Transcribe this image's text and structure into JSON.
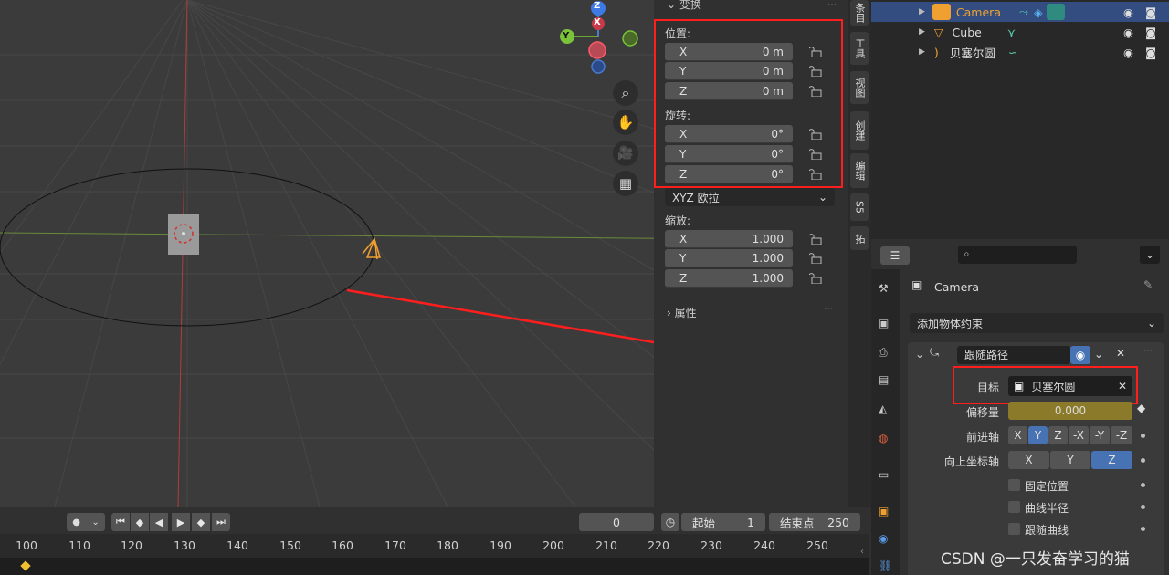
{
  "npanel": {
    "transform_header": "变换",
    "location_label": "位置:",
    "location": [
      {
        "axis": "X",
        "value": "0 m"
      },
      {
        "axis": "Y",
        "value": "0 m"
      },
      {
        "axis": "Z",
        "value": "0 m"
      }
    ],
    "rotation_label": "旋转:",
    "rotation": [
      {
        "axis": "X",
        "value": "0°"
      },
      {
        "axis": "Y",
        "value": "0°"
      },
      {
        "axis": "Z",
        "value": "0°"
      }
    ],
    "rotation_mode": "XYZ 欧拉",
    "scale_label": "缩放:",
    "scale": [
      {
        "axis": "X",
        "value": "1.000"
      },
      {
        "axis": "Y",
        "value": "1.000"
      },
      {
        "axis": "Z",
        "value": "1.000"
      }
    ],
    "properties_header": "属性"
  },
  "sidetabs": [
    "条目",
    "工具",
    "视图",
    "创建",
    "编辑",
    "S5",
    "拓"
  ],
  "gizmo": {
    "z": "Z",
    "y": "Y",
    "x": "X"
  },
  "outliner": {
    "rows": [
      {
        "name": "Camera",
        "selected": true
      },
      {
        "name": "Cube",
        "selected": false
      },
      {
        "name": "贝塞尔圆",
        "selected": false
      }
    ]
  },
  "properties": {
    "object_name": "Camera",
    "add_constraint": "添加物体约束",
    "constraint_name": "跟随路径",
    "target_label": "目标",
    "target_value": "贝塞尔圆",
    "offset_label": "偏移量",
    "offset_value": "0.000",
    "forward_label": "前进轴",
    "forward_axes": [
      "X",
      "Y",
      "Z",
      "-X",
      "-Y",
      "-Z"
    ],
    "forward_selected": "Y",
    "up_label": "向上坐标轴",
    "up_axes": [
      "X",
      "Y",
      "Z"
    ],
    "up_selected": "Z",
    "checks": [
      "固定位置",
      "曲线半径",
      "跟随曲线"
    ]
  },
  "timeline": {
    "current_frame": "0",
    "start_label": "起始",
    "start_value": "1",
    "end_label": "结束点",
    "end_value": "250",
    "ruler": [
      "100",
      "110",
      "120",
      "130",
      "140",
      "150",
      "160",
      "170",
      "180",
      "190",
      "200",
      "210",
      "220",
      "230",
      "240",
      "250"
    ]
  },
  "watermark": "CSDN @一只发奋学习的猫",
  "colors": {
    "accent": "#4772b3",
    "highlight": "#ff1e1e",
    "offset_field": "#8a7a2a",
    "camera_orange": "#f0a030"
  }
}
